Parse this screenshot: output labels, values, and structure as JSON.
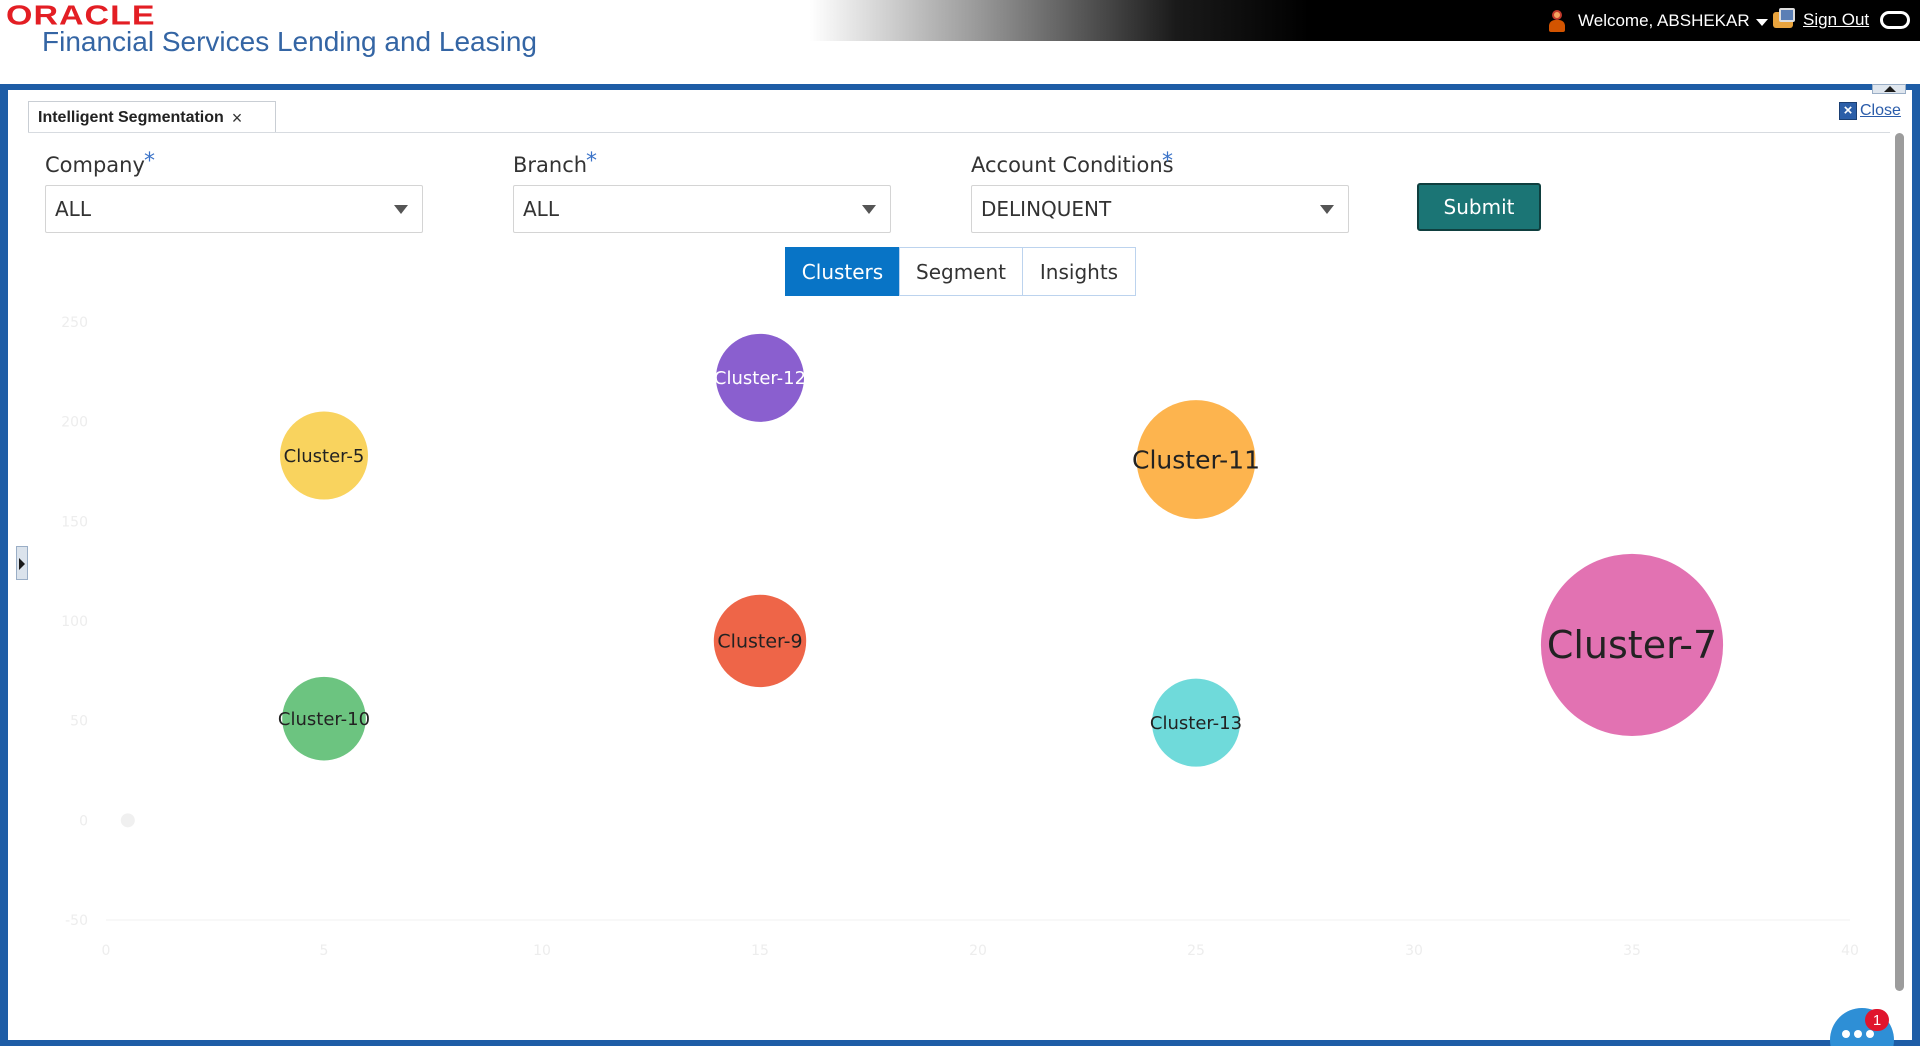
{
  "header": {
    "brand": "ORACLE",
    "product": "Financial Services Lending and Leasing",
    "welcome": "Welcome, ABSHEKAR",
    "sign_out": "Sign Out"
  },
  "tab": {
    "label": "Intelligent Segmentation",
    "close_glyph": "×"
  },
  "close_link": "Close",
  "form": {
    "company": {
      "label": "Company",
      "value": "ALL"
    },
    "branch": {
      "label": "Branch",
      "value": "ALL"
    },
    "account_conditions": {
      "label": "Account Conditions",
      "value": "DELINQUENT"
    },
    "required_mark": "*",
    "submit": "Submit"
  },
  "view_tabs": [
    {
      "label": "Clusters",
      "active": true
    },
    {
      "label": "Segment",
      "active": false
    },
    {
      "label": "Insights",
      "active": false
    }
  ],
  "chart_data": {
    "type": "scatter",
    "title": "",
    "xlabel": "",
    "ylabel": "",
    "xlim": [
      0,
      40
    ],
    "ylim": [
      -50,
      250
    ],
    "x_ticks": [
      "0",
      "5",
      "10",
      "15",
      "20",
      "25",
      "30",
      "35",
      "40"
    ],
    "y_ticks": [
      "250",
      "200",
      "150",
      "100",
      "50",
      "0",
      "-50"
    ],
    "tick_color": "#ededed",
    "points": [
      {
        "name": "Cluster-12",
        "x": 15,
        "y": 222,
        "size": 1.0,
        "color": "#8a5fcf",
        "label_color": "#ffffff"
      },
      {
        "name": "Cluster-5",
        "x": 5,
        "y": 183,
        "size": 1.0,
        "color": "#f9d35e",
        "label_color": "#222222"
      },
      {
        "name": "Cluster-11",
        "x": 25,
        "y": 181,
        "size": 1.35,
        "color": "#fdb44e",
        "label_color": "#222222"
      },
      {
        "name": "Cluster-9",
        "x": 15,
        "y": 90,
        "size": 1.05,
        "color": "#ee6548",
        "label_color": "#222222"
      },
      {
        "name": "Cluster-7",
        "x": 35,
        "y": 88,
        "size": 2.07,
        "color": "#e272b2",
        "label_color": "#222222"
      },
      {
        "name": "Cluster-10",
        "x": 5,
        "y": 51,
        "size": 0.95,
        "color": "#6cc480",
        "label_color": "#222222"
      },
      {
        "name": "Cluster-13",
        "x": 25,
        "y": 49,
        "size": 1.0,
        "color": "#6fdada",
        "label_color": "#222222"
      }
    ],
    "origin_point": {
      "x": 0.5,
      "y": 0
    }
  },
  "chat": {
    "badge_count": "1"
  }
}
